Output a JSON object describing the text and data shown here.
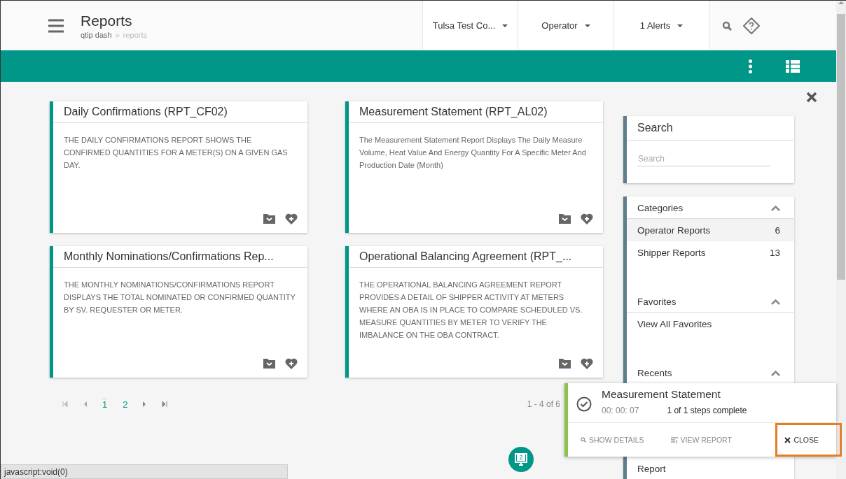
{
  "header": {
    "title": "Reports",
    "breadcrumb": [
      {
        "label": "qtip dash"
      },
      {
        "label": "»"
      },
      {
        "label": "reports"
      }
    ],
    "dropdowns": [
      {
        "label": "Tulsa Test Co..."
      },
      {
        "label": "Operator"
      },
      {
        "label": "1 Alerts"
      }
    ]
  },
  "cards": [
    {
      "title": "Daily Confirmations (RPT_CF02)",
      "description": "THE DAILY CONFIRMATIONS REPORT SHOWS THE CONFIRMED QUANTITIES FOR A METER(S) ON A GIVEN GAS DAY."
    },
    {
      "title": "Measurement Statement (RPT_AL02)",
      "description": "The Measurement Statement Report Displays The Daily Measure Volume, Heat Value And Energy Quantity For A Specific Meter And Production Date (Month)"
    },
    {
      "title": "Monthly Nominations/Confirmations Rep...",
      "description": "THE MONTHLY NOMINATIONS/CONFIRMATIONS REPORT DISPLAYS THE TOTAL NOMINATED OR CONFIRMED QUANTITY BY SV. REQUESTER OR METER."
    },
    {
      "title": "Operational Balancing Agreement (RPT_...",
      "description": "THE OPERATIONAL BALANCING AGREEMENT REPORT PROVIDES A DETAIL OF SHIPPER ACTIVITY AT METERS WHERE AN OBA IS IN PLACE TO COMPARE SCHEDULED VS. MEASURE QUANTITIES BY METER TO VERIFY THE IMBALANCE ON THE OBA CONTRACT."
    }
  ],
  "pagination": {
    "pages": [
      {
        "label": "1",
        "selected": true
      },
      {
        "label": "2",
        "selected": false
      }
    ],
    "range": "1 - 4 of 6"
  },
  "sidebar": {
    "search": {
      "title": "Search",
      "placeholder": "Search"
    },
    "sections": [
      {
        "title": "Categories",
        "expanded": true,
        "items": [
          {
            "label": "Operator Reports",
            "count": "6",
            "selected": true
          },
          {
            "label": "Shipper Reports",
            "count": "13",
            "selected": false
          }
        ]
      },
      {
        "title": "Favorites",
        "expanded": true,
        "items": [
          {
            "label": "View All Favorites",
            "selected": false
          }
        ]
      },
      {
        "title": "Recents",
        "expanded": true,
        "items": [
          {
            "label": "Report",
            "selected": false
          }
        ]
      }
    ]
  },
  "toast": {
    "title": "Measurement Statement",
    "elapsed": "00: 00: 07",
    "progress": "1 of 1 steps complete",
    "actions": [
      {
        "kind": "details",
        "label": "SHOW DETAILS",
        "highlighted": false
      },
      {
        "kind": "view",
        "label": "VIEW REPORT",
        "highlighted": false
      },
      {
        "kind": "close",
        "label": "CLOSE",
        "highlighted": true
      }
    ]
  },
  "fab": {
    "badge": "2"
  },
  "status_bar": "javascript:void(0)"
}
